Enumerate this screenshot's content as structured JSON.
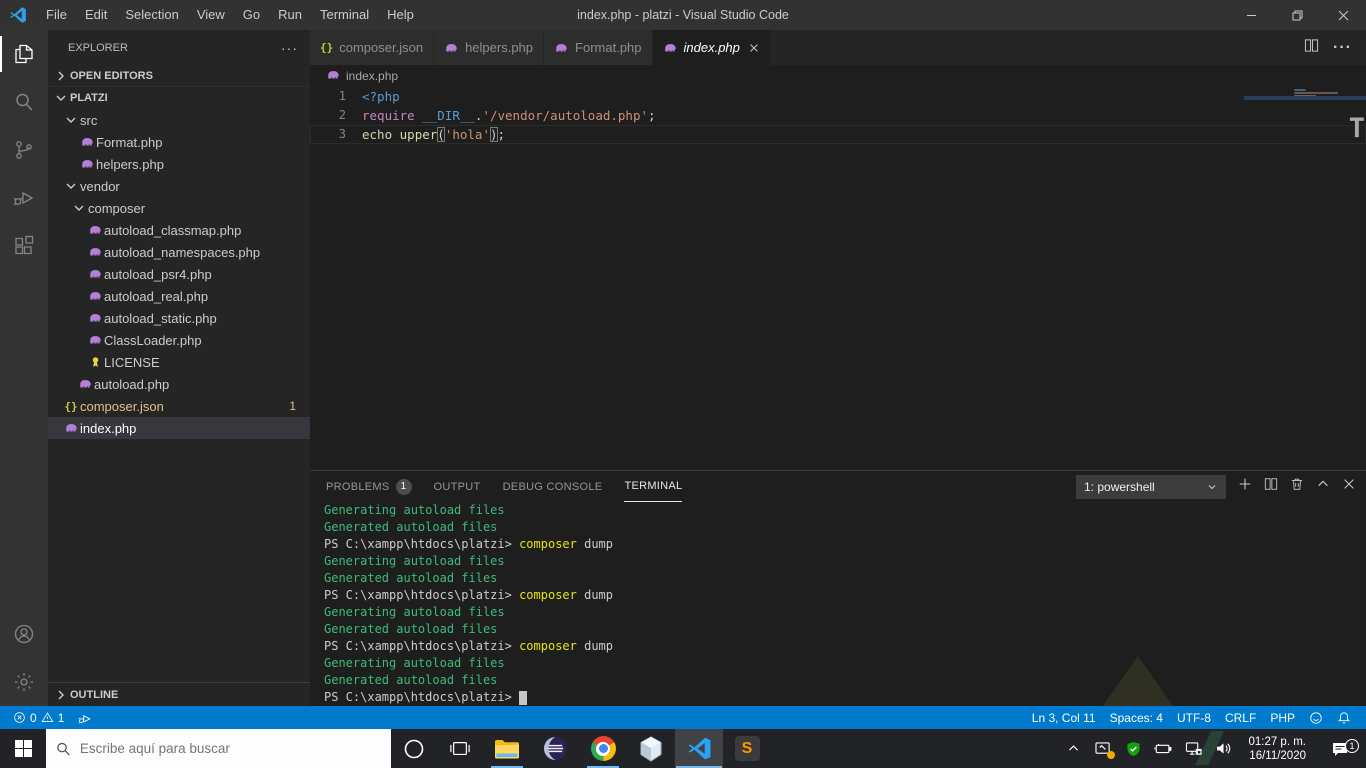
{
  "titlebar": {
    "title": "index.php - platzi - Visual Studio Code",
    "menu": [
      "File",
      "Edit",
      "Selection",
      "View",
      "Go",
      "Run",
      "Terminal",
      "Help"
    ]
  },
  "activity_bar": {
    "items": [
      {
        "name": "explorer",
        "active": true
      },
      {
        "name": "search",
        "active": false
      },
      {
        "name": "source-control",
        "active": false
      },
      {
        "name": "run-debug",
        "active": false
      },
      {
        "name": "extensions",
        "active": false
      }
    ],
    "bottom": [
      {
        "name": "account"
      },
      {
        "name": "settings"
      }
    ]
  },
  "sidebar": {
    "header": "EXPLORER",
    "tree": [
      {
        "label": "OPEN EDITORS",
        "icon": "chev-right",
        "pad": 4,
        "section": true,
        "openeditors": true
      },
      {
        "label": "PLATZI",
        "icon": "chev-down",
        "pad": 4,
        "section": true
      },
      {
        "label": "src",
        "icon": "chev-down",
        "pad": 14
      },
      {
        "label": "Format.php",
        "icon": "php",
        "pad": 30
      },
      {
        "label": "helpers.php",
        "icon": "php",
        "pad": 30
      },
      {
        "label": "vendor",
        "icon": "chev-down",
        "pad": 14
      },
      {
        "label": "composer",
        "icon": "chev-down",
        "pad": 22
      },
      {
        "label": "autoload_classmap.php",
        "icon": "php",
        "pad": 38
      },
      {
        "label": "autoload_namespaces.php",
        "icon": "php",
        "pad": 38
      },
      {
        "label": "autoload_psr4.php",
        "icon": "php",
        "pad": 38
      },
      {
        "label": "autoload_real.php",
        "icon": "php",
        "pad": 38
      },
      {
        "label": "autoload_static.php",
        "icon": "php",
        "pad": 38
      },
      {
        "label": "ClassLoader.php",
        "icon": "php",
        "pad": 38
      },
      {
        "label": "LICENSE",
        "icon": "license",
        "pad": 38
      },
      {
        "label": "autoload.php",
        "icon": "php",
        "pad": 28
      },
      {
        "label": "composer.json",
        "icon": "json",
        "pad": 14,
        "modified": true,
        "badge": "1"
      },
      {
        "label": "index.php",
        "icon": "php",
        "pad": 14,
        "selected": true
      }
    ],
    "outline": "OUTLINE"
  },
  "editor": {
    "tabs": [
      {
        "label": "composer.json",
        "icon": "json",
        "active": false
      },
      {
        "label": "helpers.php",
        "icon": "php",
        "active": false
      },
      {
        "label": "Format.php",
        "icon": "php",
        "active": false
      },
      {
        "label": "index.php",
        "icon": "php",
        "active": true,
        "preview": true
      }
    ],
    "breadcrumb": "index.php",
    "lines": [
      {
        "num": "1",
        "tokens": [
          {
            "t": "<?php",
            "c": "tag"
          }
        ]
      },
      {
        "num": "2",
        "tokens": [
          {
            "t": "require",
            "c": "kw"
          },
          {
            "t": " ",
            "c": "pl"
          },
          {
            "t": "__DIR__",
            "c": "const"
          },
          {
            "t": ".",
            "c": "pl"
          },
          {
            "t": "'/vendor/autoload.php'",
            "c": "str"
          },
          {
            "t": ";",
            "c": "pl"
          }
        ]
      },
      {
        "num": "3",
        "tokens": [
          {
            "t": "echo",
            "c": "echo"
          },
          {
            "t": " ",
            "c": "pl"
          },
          {
            "t": "upper",
            "c": "fn"
          },
          {
            "t": "(",
            "c": "br"
          },
          {
            "t": "'hola'",
            "c": "str"
          },
          {
            "t": ")",
            "c": "br"
          },
          {
            "t": ";",
            "c": "pl"
          }
        ],
        "current": true
      }
    ],
    "watermark": "T"
  },
  "panel": {
    "tabs": [
      {
        "label": "PROBLEMS",
        "badge": "1",
        "active": false
      },
      {
        "label": "OUTPUT",
        "active": false
      },
      {
        "label": "DEBUG CONSOLE",
        "active": false
      },
      {
        "label": "TERMINAL",
        "active": true
      }
    ],
    "dropdown": "1: powershell",
    "terminal_lines": [
      [
        {
          "t": "Generating autoload files",
          "c": "green"
        }
      ],
      [
        {
          "t": "Generated autoload files",
          "c": "green"
        }
      ],
      [
        {
          "t": "PS C:\\xampp\\htdocs\\platzi> ",
          "c": "plain"
        },
        {
          "t": "composer",
          "c": "yellow"
        },
        {
          "t": " dump",
          "c": "plain"
        }
      ],
      [
        {
          "t": "Generating autoload files",
          "c": "green"
        }
      ],
      [
        {
          "t": "Generated autoload files",
          "c": "green"
        }
      ],
      [
        {
          "t": "PS C:\\xampp\\htdocs\\platzi> ",
          "c": "plain"
        },
        {
          "t": "composer",
          "c": "yellow"
        },
        {
          "t": " dump",
          "c": "plain"
        }
      ],
      [
        {
          "t": "Generating autoload files",
          "c": "green"
        }
      ],
      [
        {
          "t": "Generated autoload files",
          "c": "green"
        }
      ],
      [
        {
          "t": "PS C:\\xampp\\htdocs\\platzi> ",
          "c": "plain"
        },
        {
          "t": "composer",
          "c": "yellow"
        },
        {
          "t": " dump",
          "c": "plain"
        }
      ],
      [
        {
          "t": "Generating autoload files",
          "c": "green"
        }
      ],
      [
        {
          "t": "Generated autoload files",
          "c": "green"
        }
      ],
      [
        {
          "t": "PS C:\\xampp\\htdocs\\platzi> ",
          "c": "plain"
        },
        {
          "t": "",
          "c": "plain",
          "cursor": true
        }
      ]
    ]
  },
  "status_bar": {
    "errors": "0",
    "warnings": "1",
    "right_items": [
      "Ln 3, Col 11",
      "Spaces: 4",
      "UTF-8",
      "CRLF",
      "PHP"
    ],
    "accent": "#007acc"
  },
  "taskbar": {
    "search_placeholder": "Escribe aquí para buscar",
    "apps": [
      {
        "name": "file-explorer",
        "running": true
      },
      {
        "name": "eclipse",
        "running": false
      },
      {
        "name": "chrome",
        "running": true
      },
      {
        "name": "3d-viewer",
        "running": false
      },
      {
        "name": "vscode",
        "running": true,
        "active": true
      },
      {
        "name": "sublime-text",
        "running": false
      }
    ],
    "tray": {
      "time": "01:27 p. m.",
      "date": "16/11/2020",
      "notification_count": "1"
    }
  }
}
